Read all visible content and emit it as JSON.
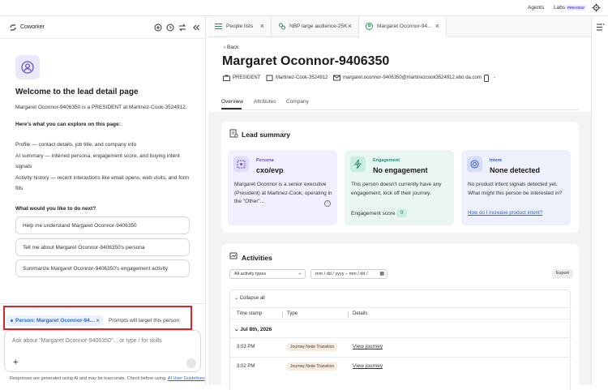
{
  "topbar": {
    "agents": "Agents",
    "labs": "Labs",
    "preview": "PREVIEW"
  },
  "coworker": {
    "title": "Coworker",
    "welcome": "Welcome to the lead detail page",
    "intro": "Margaret Oconnor-9406350 is a PRESIDENT at Martinez-Cook-3524912.",
    "explore_heading": "Here's what you can explore on this page:",
    "explore_profile": "Profile — contact details, job title, and company info",
    "explore_ai": "AI summary — inferred persona, engagement score, and buying intent signals",
    "explore_activity": "Activity history — recent interactions like email opens, web visits, and form fills",
    "next_heading": "What would you like to do next?",
    "suggestions": [
      "Help me understand Margaret Oconnor-9406350",
      "Tell me about Margaret Oconnor-9406350's persona",
      "Summarize Margaret Oconnor-9406350's engagement activity"
    ],
    "context_chip": "Person: Margaret Oconnor-94...",
    "context_note": "Prompts will target this person",
    "input_placeholder": "Ask about \"Margaret Oconnor-9406350\"... or type / for skills",
    "disclaimer": "Responses are generated using AI and may be inaccurate. Check before using.",
    "disclaimer_link": "AI User Guidelines"
  },
  "tabs": [
    {
      "label": "People lists",
      "icon": "list-icon"
    },
    {
      "label": "NBP large audience-25K",
      "icon": "audience-icon"
    },
    {
      "label": "Margaret Oconnor-94...",
      "icon": "person-icon"
    }
  ],
  "lead": {
    "back": "Back",
    "name": "Margaret Oconnor-9406350",
    "title": "PRESIDENT",
    "company": "Martinez-Cook-3524912",
    "email": "margaret.oconnor-9406350@martinezcook3524912.ebo da.com",
    "phone": "-"
  },
  "subtabs": [
    "Overview",
    "Attributes",
    "Company"
  ],
  "lead_summary": {
    "heading": "Lead summary",
    "persona": {
      "label": "Persona",
      "value": "cxo/evp",
      "desc": "Margaret Oconnor is a senior executive (President) at Martinez-Cook, operating in the \"Other\"..."
    },
    "engagement": {
      "label": "Engagement",
      "value": "No engagement",
      "desc": "This person doesn't currently have any engagement, kick off their journey.",
      "score_label": "Engagement score",
      "score": "0"
    },
    "intent": {
      "label": "Intent",
      "value": "None detected",
      "desc": "No product intent signals detected yet. What might this person be interested in?",
      "link": "How do I increase product intent?"
    }
  },
  "activities": {
    "heading": "Activities",
    "filter": "All activity types",
    "date_range": "mm / dd / yyyy  –  mm / dd /",
    "export": "Export",
    "collapse": "Collapse all",
    "columns": [
      "Time stamp",
      "Type",
      "Details"
    ],
    "date_group": "Jul 8th, 2026",
    "rows": [
      {
        "time": "3:03 PM",
        "type": "Journey Node Transition",
        "details": "View journey"
      },
      {
        "time": "3:02 PM",
        "type": "Journey Node Transition",
        "details": "View journey"
      }
    ]
  },
  "colors": {
    "accent": "#2468d8",
    "persona_bg": "#f3efff",
    "engagement_bg": "#eaf6f3",
    "intent_bg": "#eef1fb",
    "highlight": "#d6262b"
  }
}
